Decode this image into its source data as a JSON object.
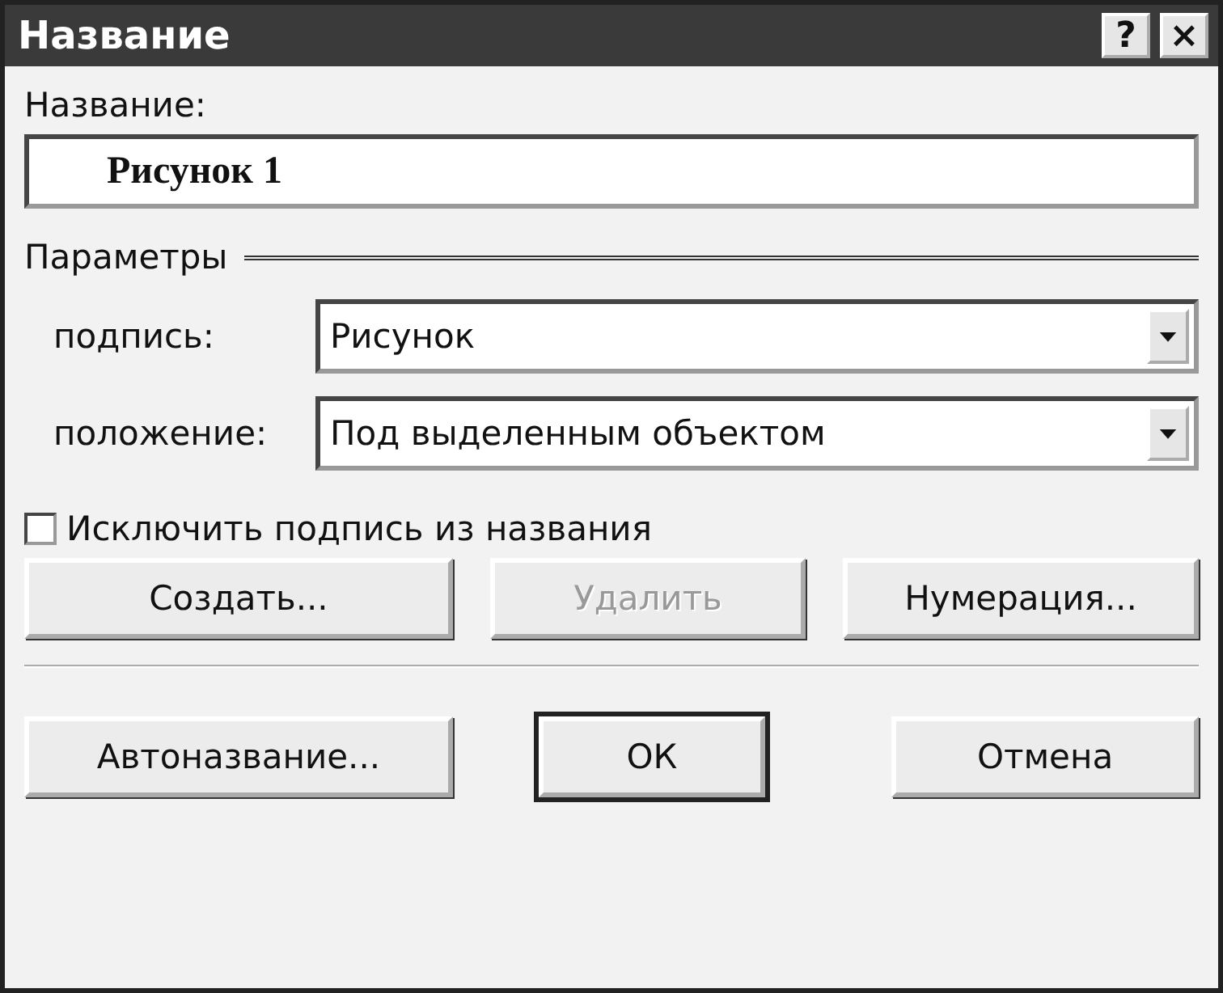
{
  "window": {
    "title": "Название",
    "help_button": "?",
    "close_button": "×"
  },
  "caption_label": "Название:",
  "caption_field": {
    "value": "Рисунок 1"
  },
  "group_title": "Параметры",
  "combos": [
    {
      "label": "подпись:",
      "value": "Рисунок"
    },
    {
      "label": "положение:",
      "value": "Под выделенным объектом"
    }
  ],
  "exclude_checkbox": {
    "label": "Исключить подпись из названия",
    "checked": false
  },
  "buttons": [
    {
      "label": "Создать...",
      "disabled": false,
      "default": false
    },
    {
      "label": "Удалить",
      "disabled": true,
      "default": false
    },
    {
      "label": "Нумерация...",
      "disabled": false,
      "default": false
    }
  ],
  "footer_buttons": [
    {
      "label": "Автоназвание...",
      "disabled": false,
      "default": false
    },
    {
      "label": "ОК",
      "disabled": false,
      "default": true
    },
    {
      "label": "Отмена",
      "disabled": false,
      "default": false
    }
  ]
}
